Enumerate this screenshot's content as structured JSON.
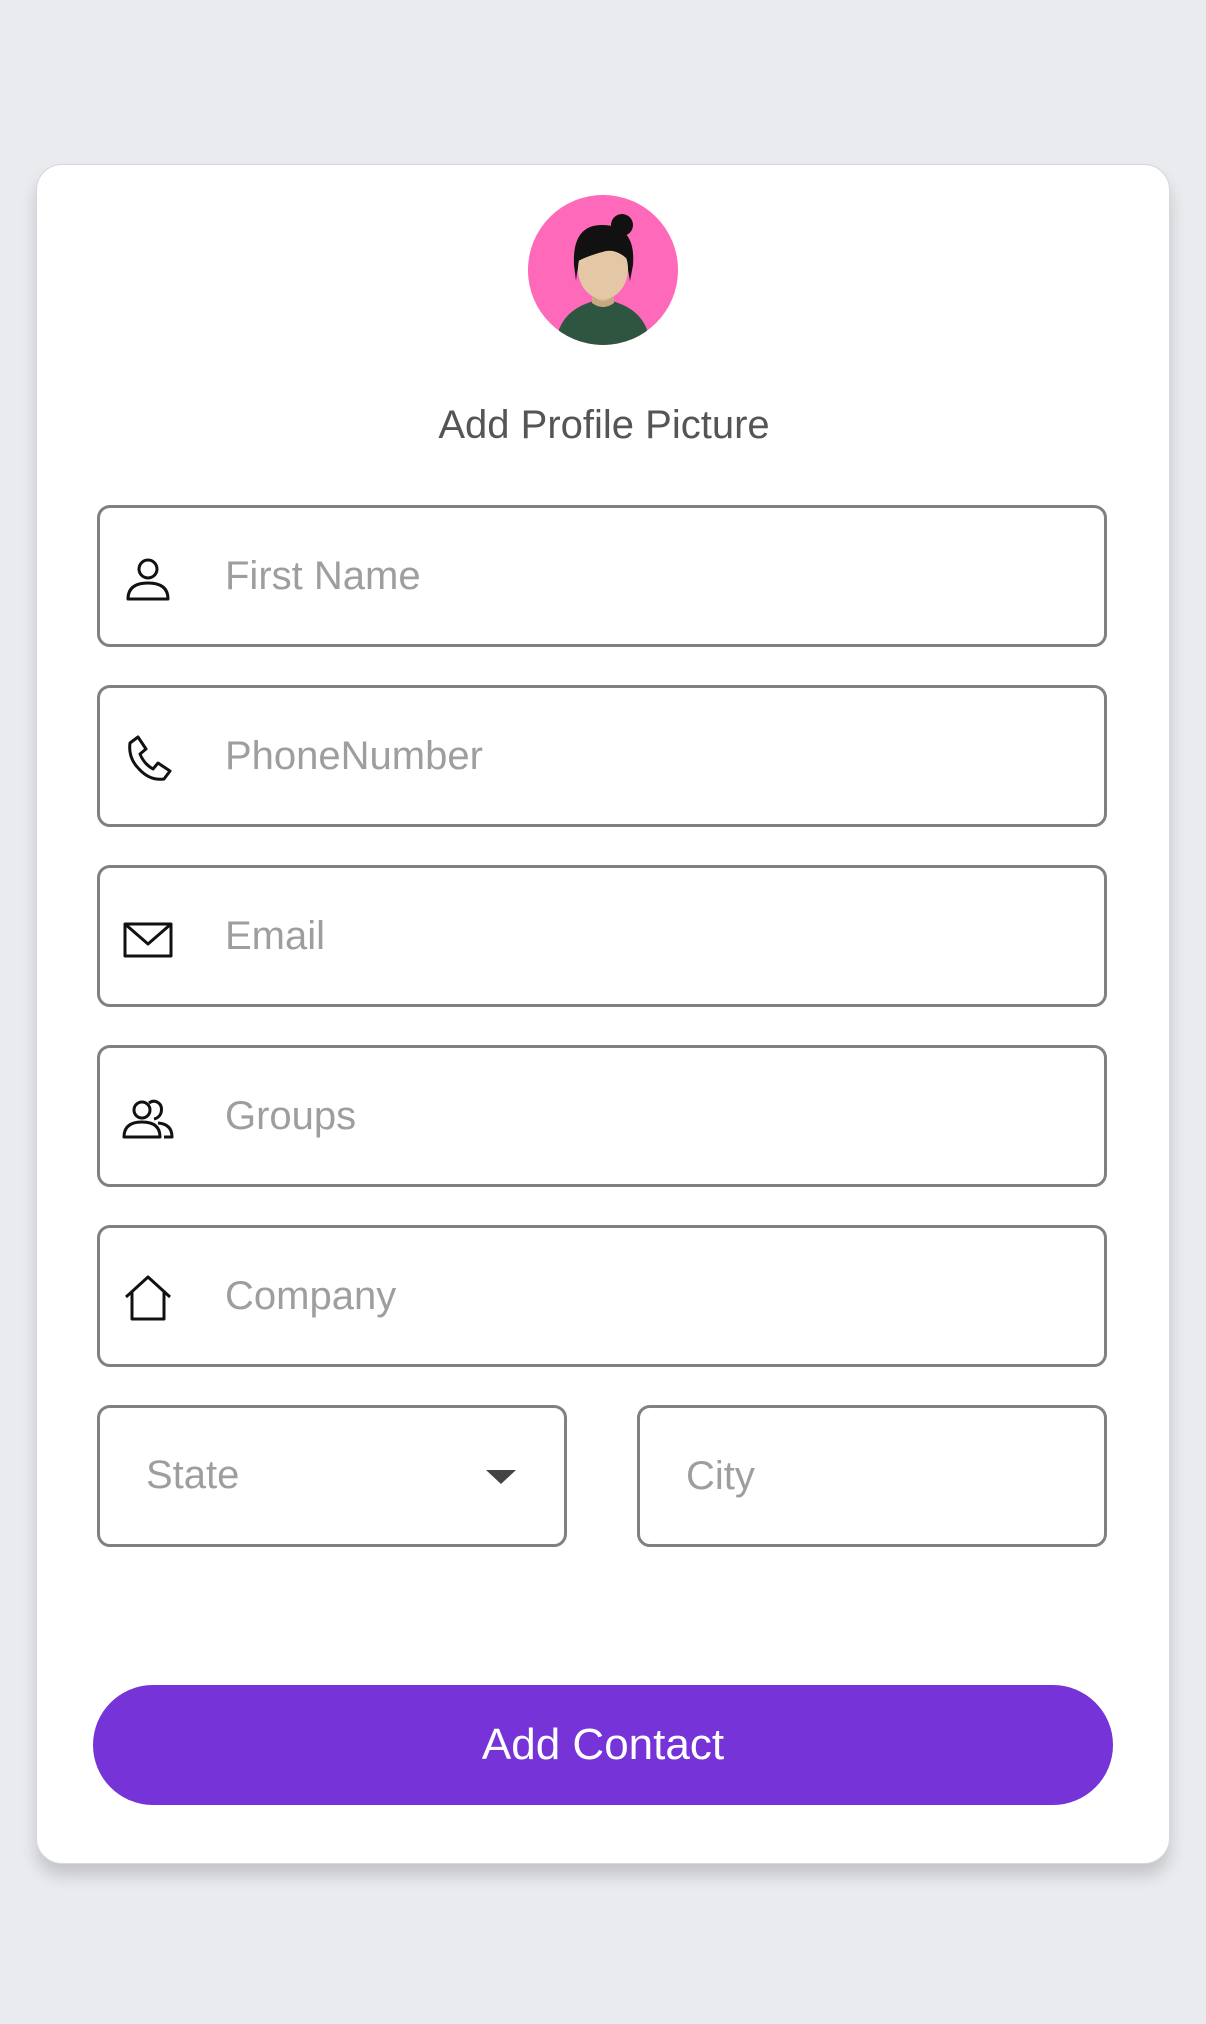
{
  "profile": {
    "avatar_icon": "female-avatar-icon",
    "caption": "Add Profile Picture",
    "avatar_bg_color": "#ff69b9"
  },
  "fields": {
    "first_name": {
      "placeholder": "First Name",
      "value": "",
      "icon": "person-icon"
    },
    "phone": {
      "placeholder": "PhoneNumber",
      "value": "",
      "icon": "phone-icon"
    },
    "email": {
      "placeholder": "Email",
      "value": "",
      "icon": "mail-icon"
    },
    "groups": {
      "placeholder": "Groups",
      "value": "",
      "icon": "group-icon"
    },
    "company": {
      "placeholder": "Company",
      "value": "",
      "icon": "home-icon"
    },
    "state": {
      "selected": "State",
      "icon": "caret-down-icon"
    },
    "city": {
      "placeholder": "City",
      "value": ""
    }
  },
  "submit": {
    "label": "Add Contact",
    "color": "#7633d8"
  }
}
